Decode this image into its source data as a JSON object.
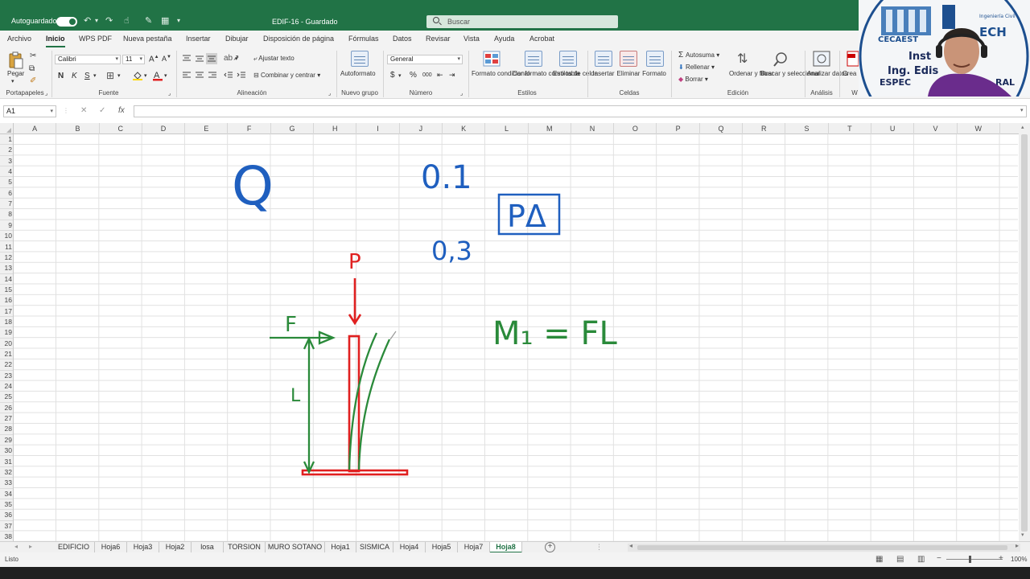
{
  "titlebar": {
    "autosave_label": "Autoguardado",
    "doc_title": "EDIF-16 - Guardado",
    "title_chevron": "▾",
    "search_placeholder": "Buscar"
  },
  "menu": [
    "Archivo",
    "Inicio",
    "WPS PDF",
    "Nueva pestaña",
    "Insertar",
    "Dibujar",
    "Disposición de página",
    "Fórmulas",
    "Datos",
    "Revisar",
    "Vista",
    "Ayuda",
    "Acrobat"
  ],
  "ribbon": {
    "paste_label": "Pegar",
    "clipboard_label": "Portapapeles",
    "font_name": "Calibri",
    "font_size": "11",
    "bold": "N",
    "italic": "K",
    "underline": "S",
    "font_group": "Fuente",
    "wrap_text": "Ajustar texto",
    "merge_center": "Combinar y centrar",
    "alignment_group": "Alineación",
    "autoformat": "Autoformato",
    "new_group": "Nuevo grupo",
    "number_format": "General",
    "currency_symbol": "$",
    "percent_symbol": "%",
    "thousands_symbol": "000",
    "number_group": "Número",
    "conditional_format": "Formato condicional",
    "format_table": "Dar formato como tabla",
    "cell_styles": "Estilos de celda",
    "styles_group": "Estilos",
    "insert": "Insertar",
    "delete": "Eliminar",
    "format": "Formato",
    "cells_group": "Celdas",
    "autosum": "Autosuma",
    "fill": "Rellenar",
    "clear": "Borrar",
    "sort_filter": "Ordenar y filtrar",
    "find_select": "Buscar y seleccionar",
    "editing_group": "Edición",
    "analyze_data": "Analizar datos",
    "analysis_group": "Análisis",
    "create_pdf": "Crea PDF",
    "partial_group": "W"
  },
  "formula_bar": {
    "name_box": "A1",
    "cancel_symbol": "✕",
    "enter_symbol": "✓",
    "fx_symbol": "fx",
    "formula": ""
  },
  "columns": [
    "A",
    "B",
    "C",
    "D",
    "E",
    "F",
    "G",
    "H",
    "I",
    "J",
    "K",
    "L",
    "M",
    "N",
    "O",
    "P",
    "Q",
    "R",
    "S",
    "T",
    "U",
    "V",
    "W"
  ],
  "rows": [
    "1",
    "2",
    "3",
    "4",
    "5",
    "6",
    "7",
    "8",
    "9",
    "10",
    "11",
    "12",
    "13",
    "14",
    "15",
    "16",
    "17",
    "18",
    "19",
    "20",
    "21",
    "22",
    "23",
    "24",
    "25",
    "26",
    "27",
    "28",
    "29",
    "30",
    "31",
    "32",
    "33",
    "34",
    "35",
    "36",
    "37",
    "38"
  ],
  "sheets": [
    "EDIFICIO",
    "Hoja6",
    "Hoja3",
    "Hoja2",
    "losa",
    "TORSION",
    "MURO SOTANO",
    "Hoja1",
    "SISMICA",
    "Hoja4",
    "Hoja5",
    "Hoja7",
    "Hoja8"
  ],
  "active_sheet": "Hoja8",
  "add_sheet_symbol": "+",
  "sheet_nav_prev": "◂",
  "sheet_nav_next": "▸",
  "status": {
    "ready": "Listo",
    "zoom": "100%"
  },
  "ink_annotations": {
    "q_letter": "Q",
    "value_top": "0.1",
    "value_bottom": "0,3",
    "p_delta": "PΔ",
    "load_p": "P",
    "force_f": "F",
    "length_l": "L",
    "moment_eq": "M₁ = FL",
    "color_blue": "#1f5fbf",
    "color_red": "#e02020",
    "color_green": "#2a8a3a"
  },
  "webcam_overlay": {
    "logo_text": "CECAEST",
    "line1": "Inst",
    "line2": "Ing. Edis",
    "line3": "ESPEC",
    "line4": "RAL",
    "badge": "ECH",
    "badge_small": "Ingeniería Civil"
  },
  "colors": {
    "excel_green": "#217346",
    "ribbon_bg": "#f3f3f3"
  }
}
